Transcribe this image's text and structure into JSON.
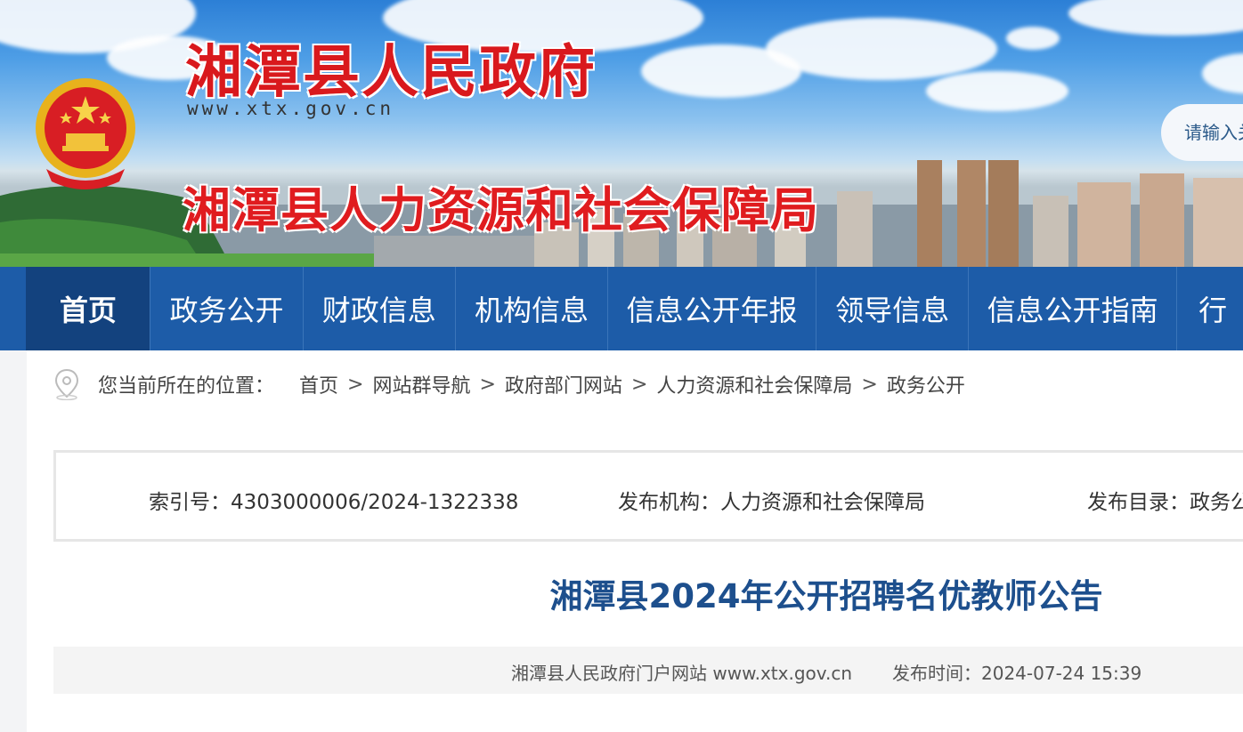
{
  "header": {
    "site_title": "湘潭县人民政府",
    "site_url": "www.xtx.gov.cn",
    "department": "湘潭县人力资源和社会保障局",
    "search_placeholder": "请输入关键字"
  },
  "nav": {
    "items": [
      {
        "label": "首页",
        "active": true
      },
      {
        "label": "政务公开"
      },
      {
        "label": "财政信息"
      },
      {
        "label": "机构信息"
      },
      {
        "label": "信息公开年报"
      },
      {
        "label": "领导信息"
      },
      {
        "label": "信息公开指南"
      },
      {
        "label": "行"
      }
    ]
  },
  "breadcrumb": {
    "lead": "您当前所在的位置：",
    "items": [
      "首页",
      "网站群导航",
      "政府部门网站",
      "人力资源和社会保障局",
      "政务公开"
    ],
    "separator": ">"
  },
  "meta": {
    "index_label": "索引号：",
    "index_value": "4303000006/2024-1322338",
    "publisher_label": "发布机构：",
    "publisher_value": "人力资源和社会保障局",
    "catalog_label": "发布目录：",
    "catalog_value": "政务公开"
  },
  "article": {
    "title": "湘潭县2024年公开招聘名优教师公告",
    "source": "湘潭县人民政府门户网站 www.xtx.gov.cn",
    "publish_time": "发布时间：2024-07-24 15:39"
  },
  "colors": {
    "nav_bg": "#1d5ca8",
    "nav_active": "#13427e",
    "title_red": "#d9191d",
    "article_title": "#1d4f8d"
  }
}
